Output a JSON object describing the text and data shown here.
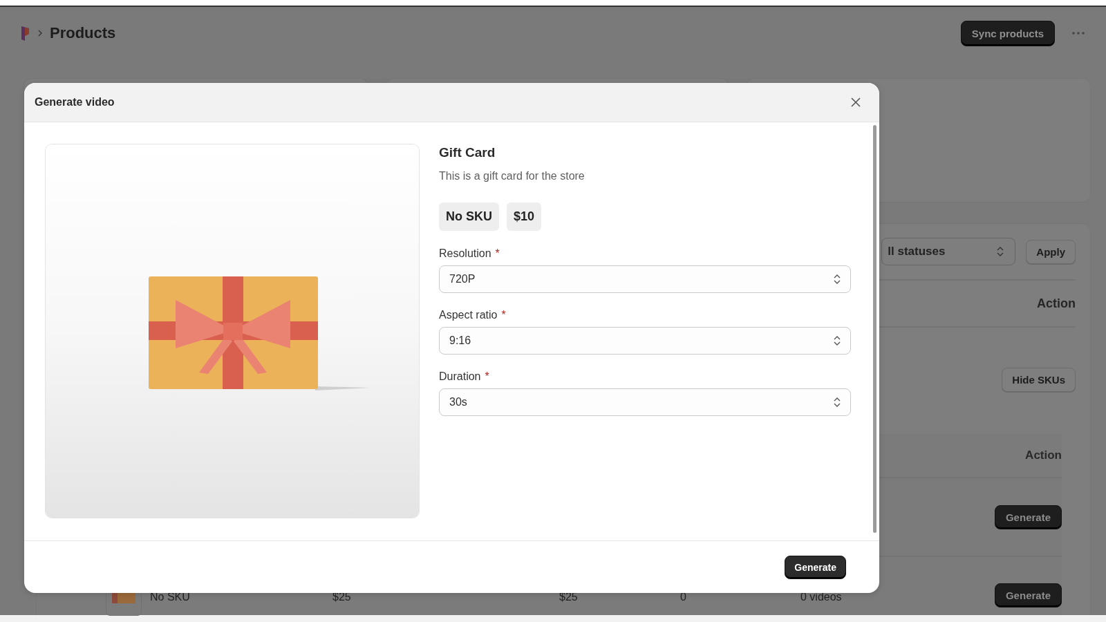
{
  "header": {
    "title": "Products",
    "primary_button": "Sync products"
  },
  "filters": {
    "status_select": "ll statuses",
    "apply_button": "Apply"
  },
  "products_table": {
    "action_header": "Action",
    "row_button": "Hide SKUs"
  },
  "sku_table": {
    "action_header": "Action",
    "rows": [
      {
        "cells": [],
        "button": "Generate"
      },
      {
        "cells": [
          "No SKU",
          "$25",
          "$25",
          "0",
          "0 videos"
        ],
        "button": "Generate"
      }
    ]
  },
  "dialog": {
    "title": "Generate video",
    "product": {
      "name": "Gift Card",
      "description": "This is a gift card for the store",
      "badges": [
        "No SKU",
        "$10"
      ]
    },
    "fields": [
      {
        "label": "Resolution",
        "required_mark": "*",
        "value": "720P"
      },
      {
        "label": "Aspect ratio",
        "required_mark": "*",
        "value": "9:16"
      },
      {
        "label": "Duration",
        "required_mark": "*",
        "value": "30s"
      }
    ],
    "submit_button": "Generate"
  }
}
